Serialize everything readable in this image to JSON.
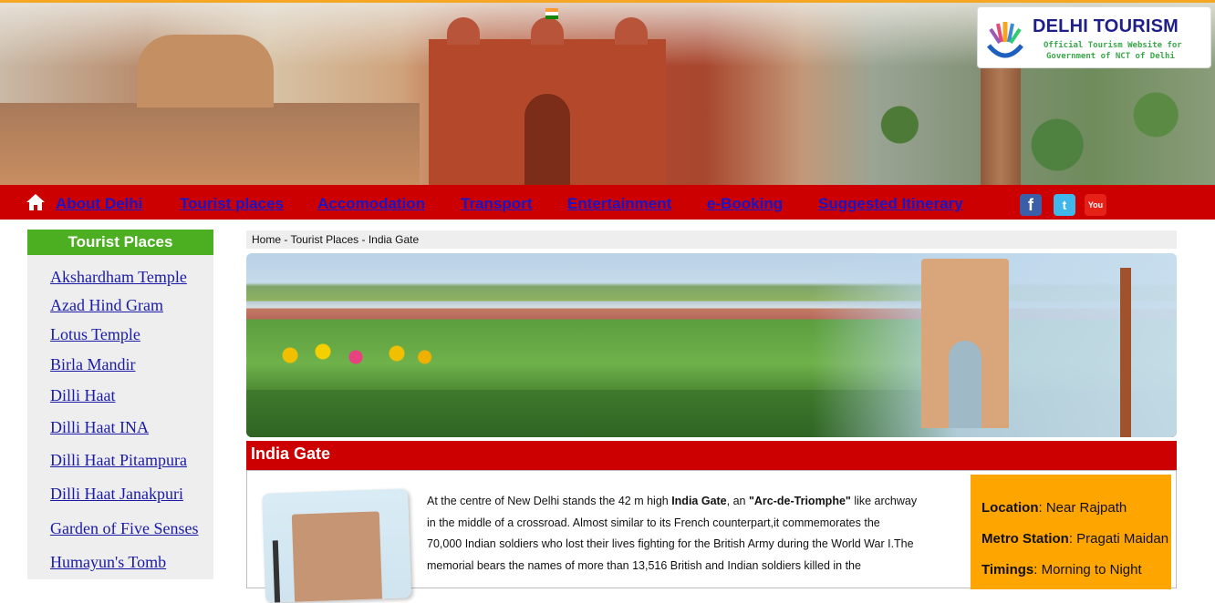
{
  "logo": {
    "title": "DELHI TOURISM",
    "sub1": "Official Tourism Website for",
    "sub2": "Government of NCT of Delhi"
  },
  "nav": {
    "items": [
      {
        "label": "About Delhi"
      },
      {
        "label": "Tourist places"
      },
      {
        "label": "Accomodation"
      },
      {
        "label": "Transport"
      },
      {
        "label": "Entertainment"
      },
      {
        "label": "e-Booking"
      },
      {
        "label": "Suggested Itinerary"
      }
    ],
    "social": {
      "facebook": "f",
      "twitter": "t",
      "youtube": "You Tube"
    }
  },
  "sidebar": {
    "title": "Tourist Places",
    "items": [
      {
        "label": "Akshardham Temple"
      },
      {
        "label": "Azad Hind Gram"
      },
      {
        "label": "Lotus Temple"
      },
      {
        "label": "Birla Mandir"
      },
      {
        "label": "Dilli Haat"
      },
      {
        "label": "Dilli Haat INA"
      },
      {
        "label": "Dilli Haat Pitampura"
      },
      {
        "label": "Dilli Haat Janakpuri"
      },
      {
        "label": "Garden of Five Senses"
      },
      {
        "label": "Humayun's Tomb"
      }
    ]
  },
  "breadcrumb": "Home - Tourist Places - India Gate",
  "section_title": "India Gate",
  "description": {
    "line1_a": "At the centre of New Delhi stands the 42 m high ",
    "line1_b": "India Gate",
    "line1_c": ", an ",
    "line1_d": "\"Arc-de-Triomphe\"",
    "line1_e": " like archway",
    "line2": "in the middle of a crossroad. Almost similar to its French counterpart,it commemorates the",
    "line3": "70,000 Indian soldiers who lost their lives fighting for the British Army during the World War I.The",
    "line4": "memorial bears the names of more than 13,516 British and Indian soldiers killed in the"
  },
  "info": {
    "location_label": "Location",
    "location_value": ": Near Rajpath",
    "metro_label": "Metro Station",
    "metro_value": ": Pragati Maidan",
    "timings_label": "Timings",
    "timings_value": ": Morning to Night"
  },
  "colors": {
    "nav_bg": "#cc0000",
    "link": "#1616cc",
    "sidebar_head": "#4caf21",
    "info_bg": "#ffa500"
  }
}
